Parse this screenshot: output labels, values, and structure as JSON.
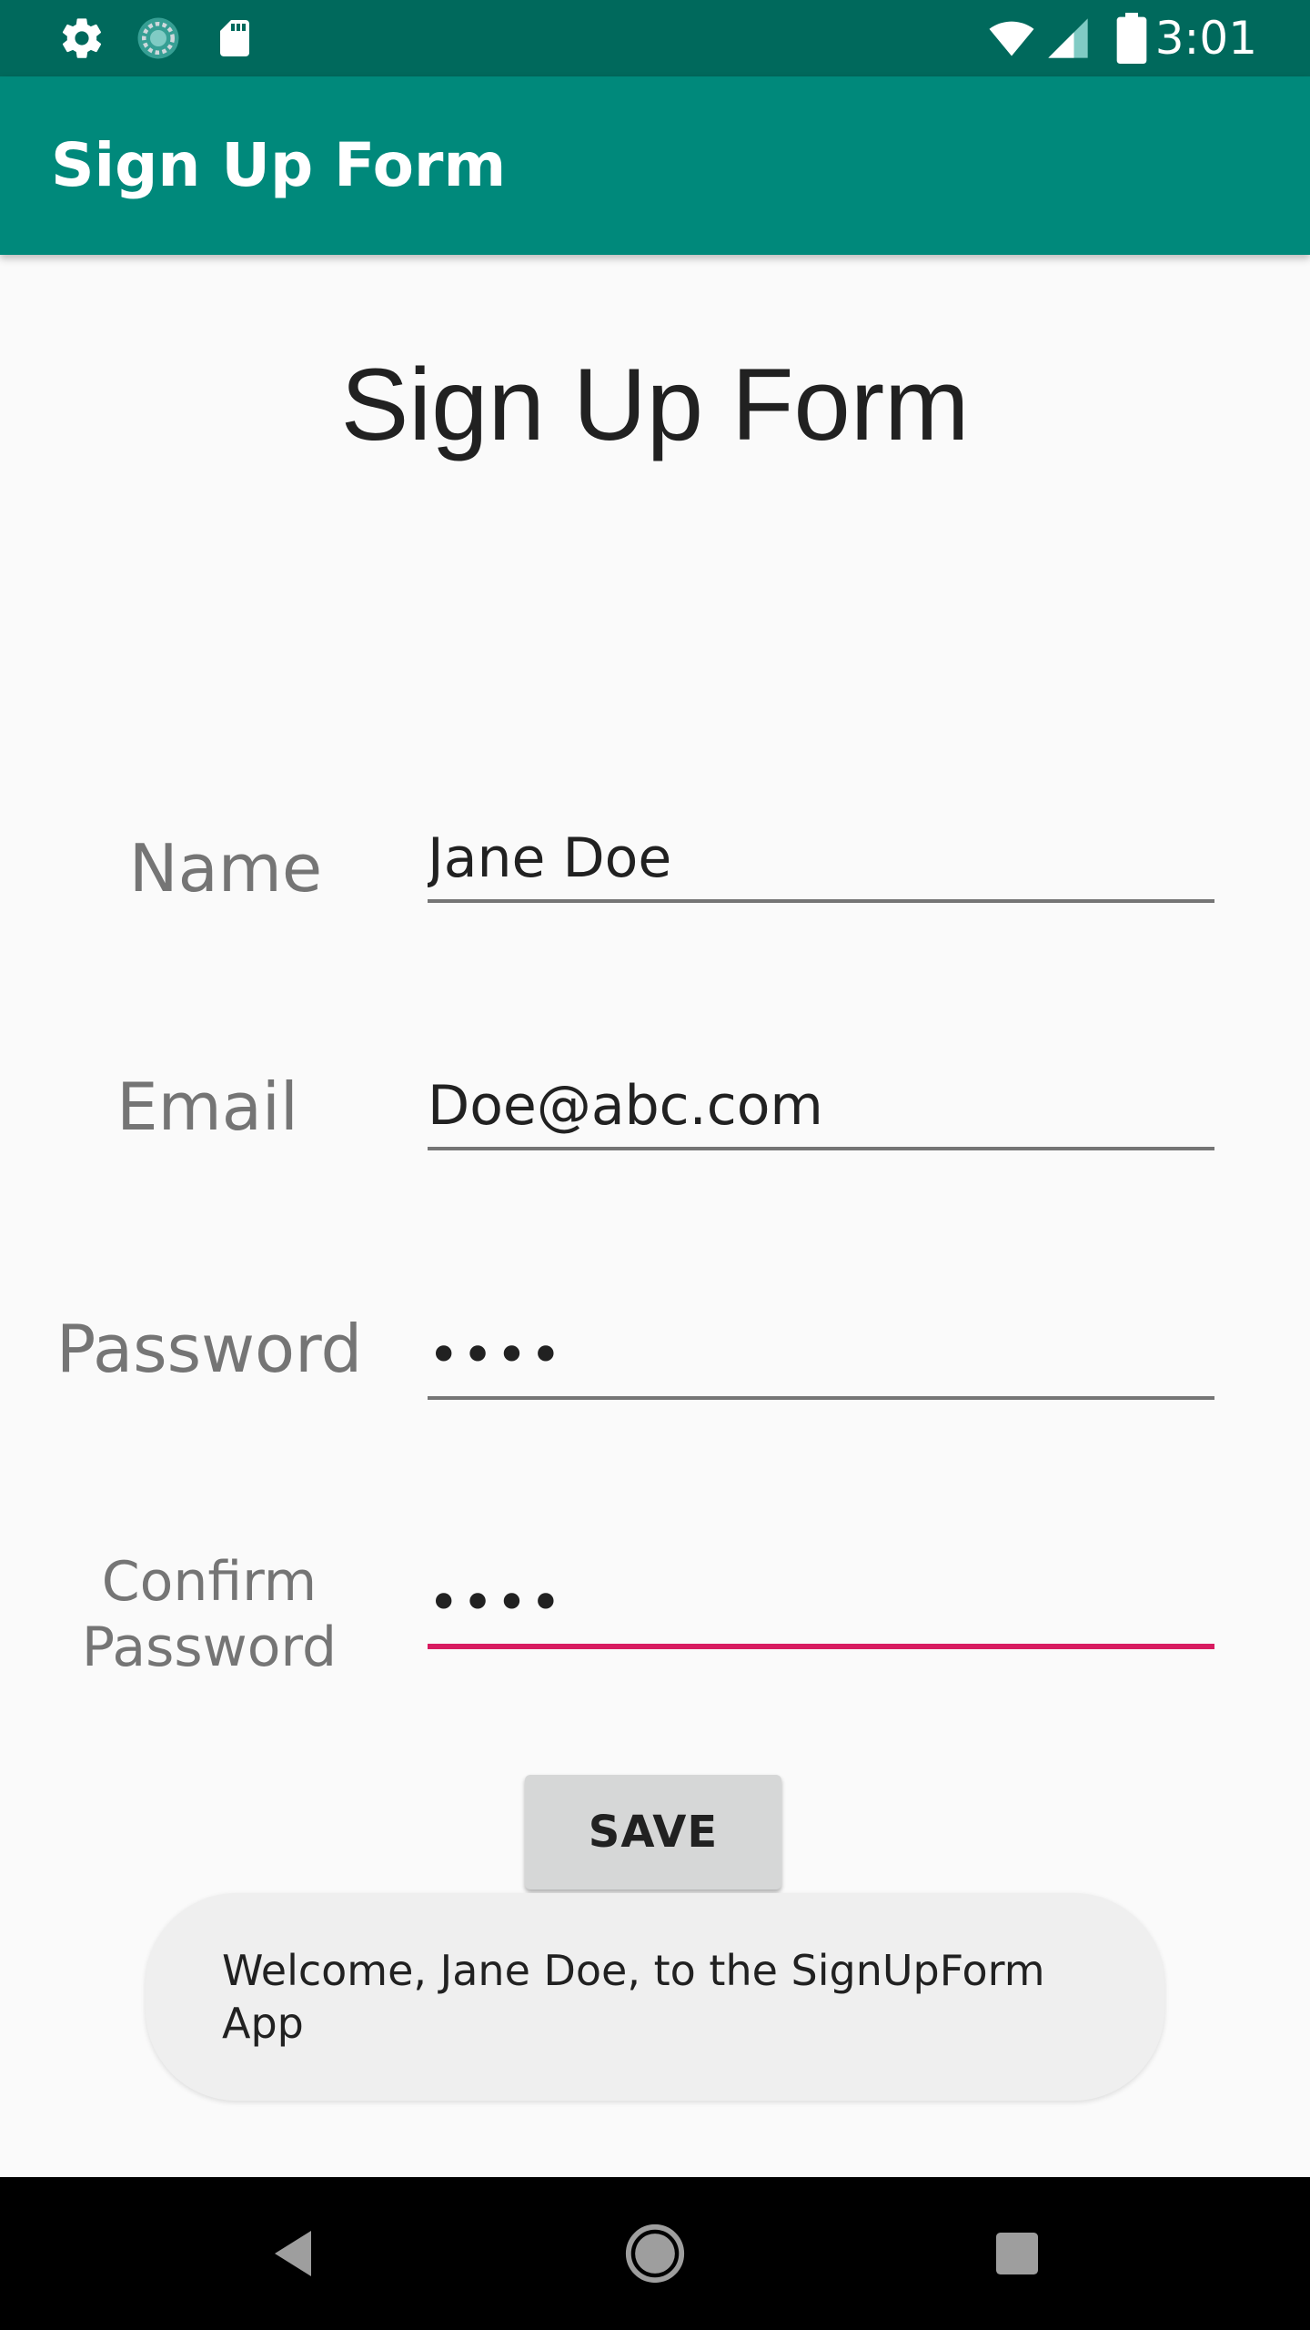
{
  "status_bar": {
    "time": "3:01",
    "icons": [
      "gear-icon",
      "sync-icon",
      "sd-card-icon",
      "wifi-icon",
      "signal-icon",
      "battery-icon"
    ]
  },
  "app_bar": {
    "title": "Sign Up Form"
  },
  "main": {
    "heading": "Sign Up Form",
    "fields": {
      "name": {
        "label": "Name",
        "value": "Jane Doe"
      },
      "email": {
        "label": "Email",
        "value": "Doe@abc.com"
      },
      "password": {
        "label": "Password",
        "value": "••••"
      },
      "confirm_password": {
        "label_line1": "Confirm",
        "label_line2": "Password",
        "value": "••••"
      }
    },
    "save_label": "SAVE"
  },
  "toast": {
    "message": "Welcome, Jane Doe, to the SignUpForm App"
  },
  "nav_bar": {
    "icons": [
      "back-icon",
      "home-icon",
      "recents-icon"
    ]
  },
  "colors": {
    "status_bar": "#00695c",
    "app_bar": "#00897b",
    "accent": "#d81b60",
    "background": "#fafafa"
  }
}
